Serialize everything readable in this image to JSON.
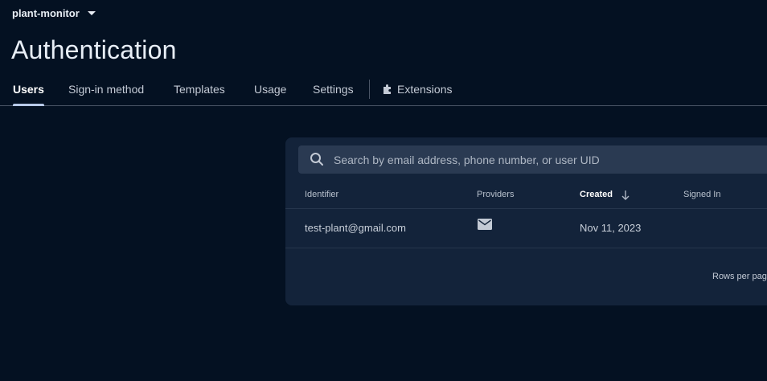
{
  "project": {
    "name": "plant-monitor",
    "icon": "chevron-down-icon"
  },
  "page": {
    "title": "Authentication"
  },
  "tabs": [
    {
      "label": "Users",
      "active": true
    },
    {
      "label": "Sign-in method"
    },
    {
      "label": "Templates"
    },
    {
      "label": "Usage"
    },
    {
      "label": "Settings"
    },
    {
      "label": "Extensions",
      "icon": "extensions-icon"
    }
  ],
  "search": {
    "placeholder": "Search by email address, phone number, or user UID",
    "value": "",
    "icon": "search-icon"
  },
  "table": {
    "columns": [
      {
        "label": "Identifier"
      },
      {
        "label": "Providers"
      },
      {
        "label": "Created",
        "sorted": "desc",
        "icon": "arrow-down-icon"
      },
      {
        "label": "Signed In"
      }
    ],
    "rows": [
      {
        "identifier": "test-plant@gmail.com",
        "provider_icon": "email-icon",
        "created": "Nov 11, 2023",
        "signed_in": ""
      }
    ]
  },
  "pagination": {
    "rows_per_page_label": "Rows per pag"
  },
  "colors": {
    "background": "#041122",
    "card": "#13233a",
    "search_bg": "#2a3a52",
    "active_tab_indicator": "#b7c9e8"
  }
}
